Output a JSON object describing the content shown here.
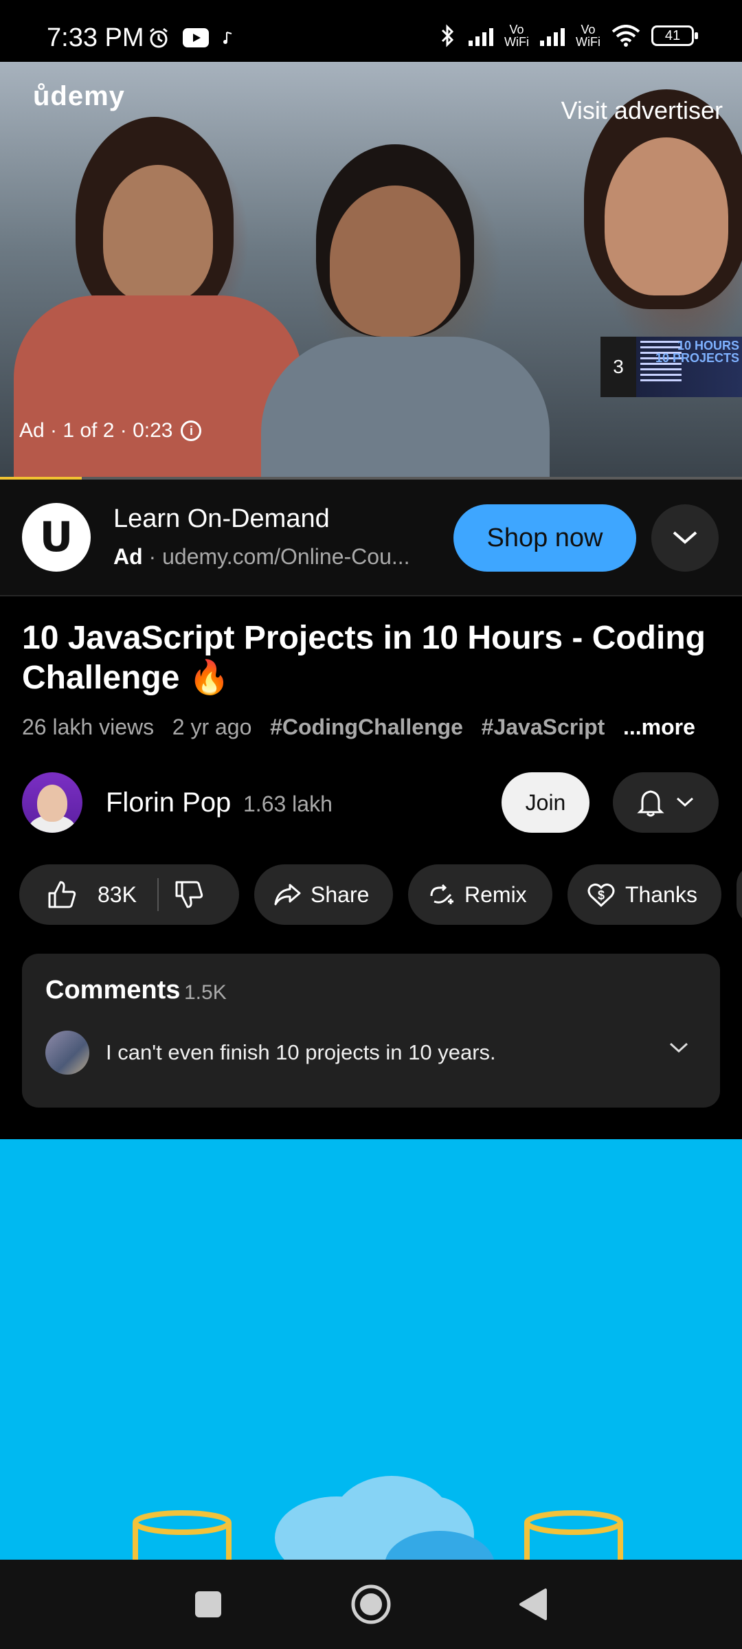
{
  "status_bar": {
    "time": "7:33 PM",
    "battery": "41",
    "vowifi_label_1": "Vo\nWiFi",
    "vowifi_label_2": "Vo\nWiFi"
  },
  "video_player": {
    "brand_logo": "ůdemy",
    "visit_advertiser": "Visit advertiser",
    "ad_meta": "Ad · 1 of 2 · 0:23",
    "up_next_count": "3",
    "up_next_thumb_title": "10 HOURS\n10 PROJECTS",
    "progress_fraction": 0.11
  },
  "ad_row": {
    "logo_letter": "U",
    "title": "Learn On-Demand",
    "ad_label": "Ad",
    "url": "udemy.com/Online-Cou...",
    "cta": "Shop now"
  },
  "video": {
    "title": "10 JavaScript Projects in 10 Hours - Coding Challenge 🔥",
    "views": "26 lakh views",
    "age": "2 yr ago",
    "tags": [
      "#CodingChallenge",
      "#JavaScript"
    ],
    "more": "...more"
  },
  "channel": {
    "name": "Florin Pop",
    "subscribers": "1.63 lakh",
    "join": "Join"
  },
  "actions": {
    "likes": "83K",
    "share": "Share",
    "remix": "Remix",
    "thanks": "Thanks"
  },
  "comments": {
    "label": "Comments",
    "count": "1.5K",
    "top_comment": "I can't even finish 10 projects in 10 years."
  },
  "colors": {
    "accent_blue": "#3ea6ff",
    "progress_yellow": "#f1c232",
    "lower_video_bg": "#00b9f1"
  }
}
